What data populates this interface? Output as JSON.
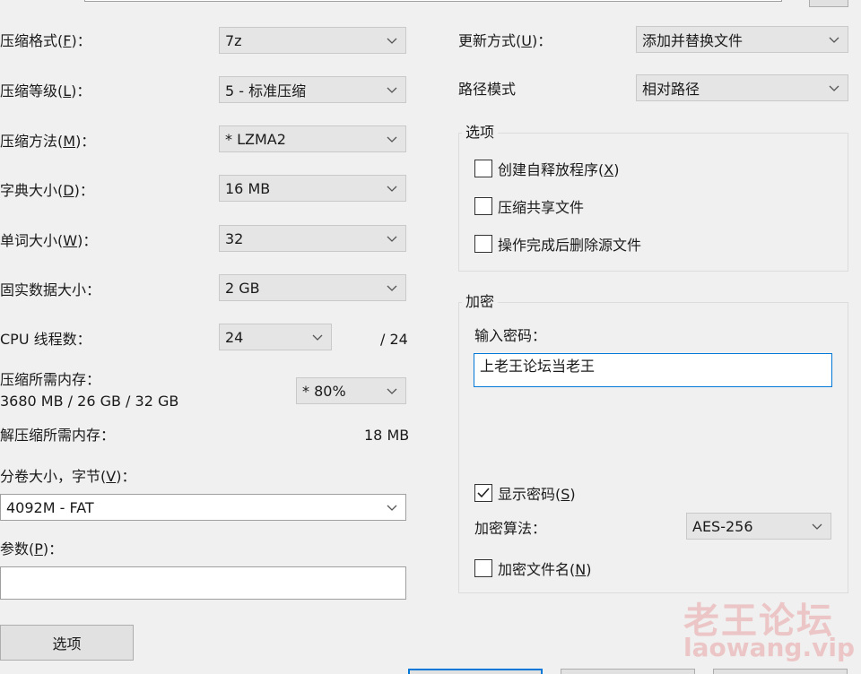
{
  "colors": {
    "accent": "#0078d7",
    "watermark": "#e67878"
  },
  "left": {
    "format": {
      "label_prefix": "压缩格式(",
      "key": "F",
      "label_suffix": ")：",
      "value": "7z"
    },
    "level": {
      "label_prefix": "压缩等级(",
      "key": "L",
      "label_suffix": ")：",
      "value": "5 - 标准压缩"
    },
    "method": {
      "label_prefix": "压缩方法(",
      "key": "M",
      "label_suffix": ")：",
      "value": "* LZMA2"
    },
    "dict": {
      "label_prefix": "字典大小(",
      "key": "D",
      "label_suffix": ")：",
      "value": "16 MB"
    },
    "word": {
      "label_prefix": "单词大小(",
      "key": "W",
      "label_suffix": ")：",
      "value": "32"
    },
    "solid": {
      "label": "固实数据大小：",
      "value": "2 GB"
    },
    "threads": {
      "label": "CPU 线程数：",
      "value": "24",
      "max": "/ 24"
    },
    "mem_compress": {
      "label": "压缩所需内存：",
      "detail": "3680 MB / 26 GB / 32 GB",
      "value": "* 80%"
    },
    "mem_decompress": {
      "label": "解压缩所需内存：",
      "value": "18 MB"
    },
    "volume": {
      "label_prefix": "分卷大小，字节(",
      "key": "V",
      "label_suffix": ")：",
      "value": "4092M - FAT"
    },
    "params": {
      "label_prefix": "参数(",
      "key": "P",
      "label_suffix": ")：",
      "value": ""
    },
    "options_button": "选项"
  },
  "right": {
    "update": {
      "label_prefix": "更新方式(",
      "key": "U",
      "label_suffix": ")：",
      "value": "添加并替换文件"
    },
    "path": {
      "label": "路径模式",
      "value": "相对路径"
    },
    "options_group": {
      "title": "选项",
      "sfx": {
        "label_prefix": "创建自释放程序(",
        "key": "X",
        "label_suffix": ")",
        "checked": false
      },
      "shared": {
        "label": "压缩共享文件",
        "checked": false
      },
      "delete": {
        "label": "操作完成后删除源文件",
        "checked": false
      }
    },
    "encrypt_group": {
      "title": "加密",
      "password_label": "输入密码：",
      "password_value": "上老王论坛当老王",
      "show_password": {
        "label_prefix": "显示密码(",
        "key": "S",
        "label_suffix": ")",
        "checked": true
      },
      "method_label": "加密算法：",
      "method_value": "AES-256",
      "encrypt_names": {
        "label_prefix": "加密文件名(",
        "key": "N",
        "label_suffix": ")",
        "checked": false
      }
    }
  },
  "watermark": {
    "cn": "老王论坛",
    "en": "laowang.vip"
  }
}
